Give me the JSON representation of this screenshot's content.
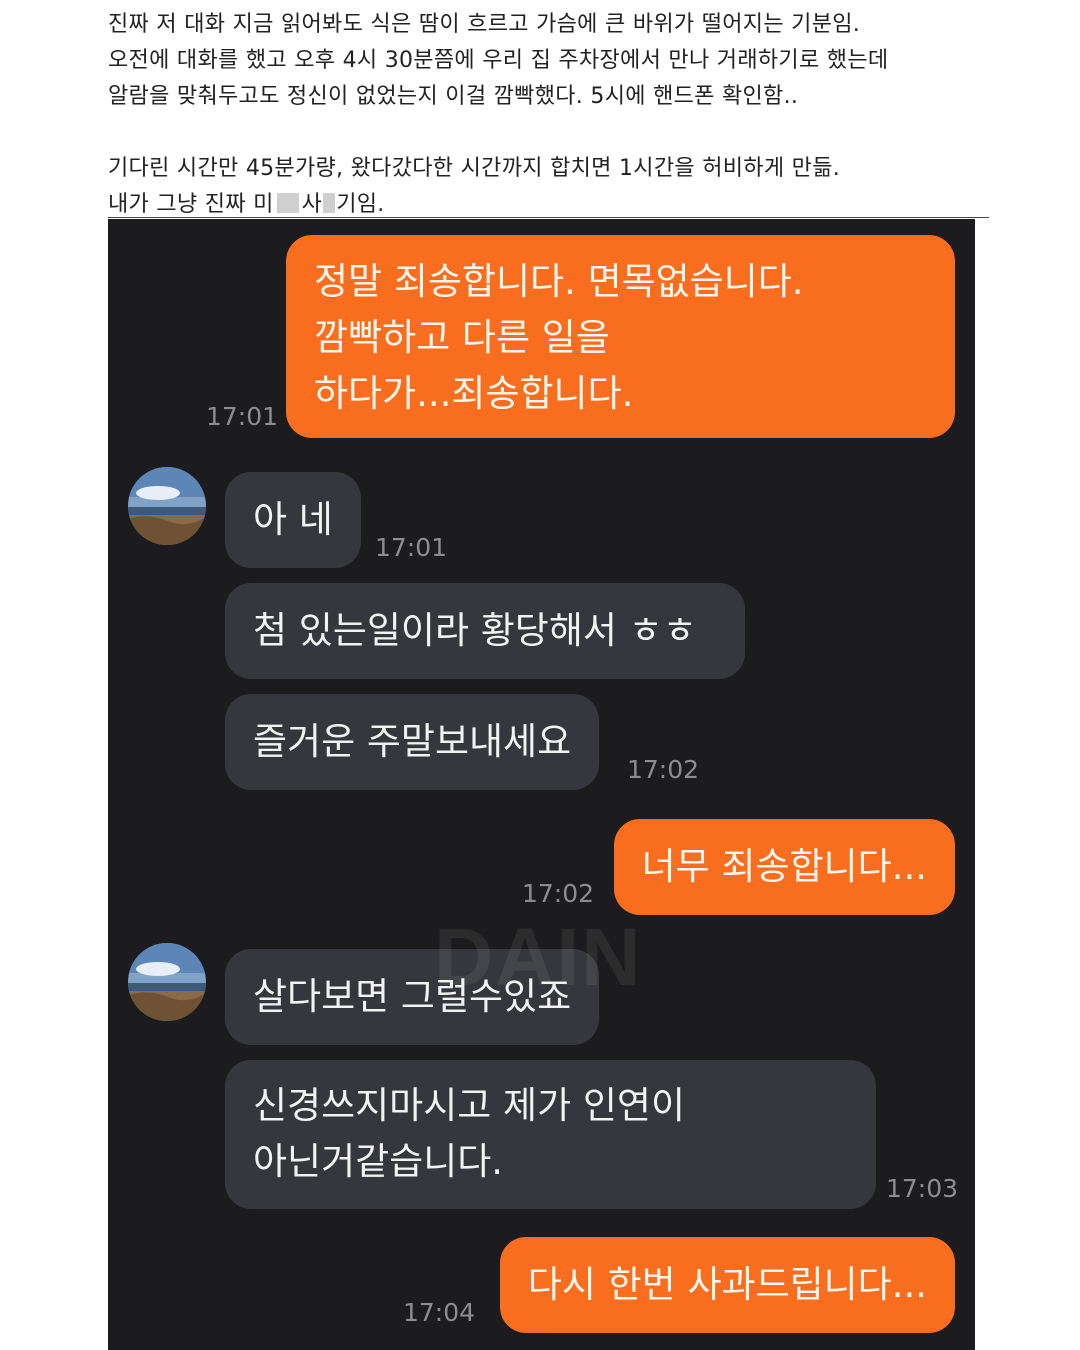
{
  "post": {
    "lines": [
      "진짜 저 대화 지금 읽어봐도 식은 땀이 흐르고 가슴에 큰 바위가 떨어지는 기분임.",
      "오전에 대화를 했고 오후 4시 30분쯤에 우리 집 주차장에서 만나 거래하기로 했는데",
      "알람을 맞춰두고도 정신이 없었는지 이걸 깜빡했다. 5시에 핸드폰 확인함..",
      "기다린 시간만 45분가량, 왔다갔다한 시간까지 합치면 1시간을 허비하게 만듦."
    ],
    "censored_line": {
      "part1": "내가 그냥 진짜 미",
      "part2": "사",
      "part3": "기임."
    }
  },
  "chat": {
    "watermark": "DAIN",
    "messages": [
      {
        "side": "out",
        "lines": [
          "정말 죄송합니다. 면목없습니다.",
          "깜빡하고 다른 일을",
          "하다가...죄송합니다."
        ],
        "time": "17:01"
      },
      {
        "side": "in",
        "lines": [
          "아 네"
        ],
        "time": "17:01"
      },
      {
        "side": "in",
        "lines": [
          "첨 있는일이라 황당해서 ㅎㅎ"
        ]
      },
      {
        "side": "in",
        "lines": [
          "즐거운 주말보내세요"
        ],
        "time": "17:02"
      },
      {
        "side": "out",
        "lines": [
          "너무 죄송합니다..."
        ],
        "time": "17:02"
      },
      {
        "side": "in",
        "lines": [
          "살다보면 그럴수있죠"
        ]
      },
      {
        "side": "in",
        "lines": [
          "신경쓰지마시고 제가 인연이",
          "아닌거같습니다."
        ],
        "time": "17:03"
      },
      {
        "side": "out",
        "lines": [
          "다시 한번 사과드립니다..."
        ],
        "time": "17:04"
      }
    ]
  }
}
